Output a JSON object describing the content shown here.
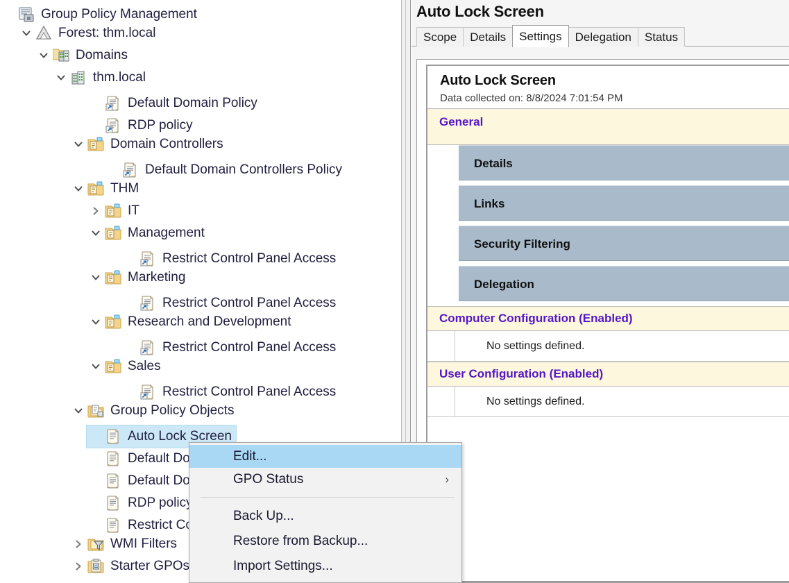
{
  "tree": {
    "items": [
      {
        "label": "Group Policy Management",
        "indent": 0,
        "twisty": "none",
        "icon": "console-root-icon"
      },
      {
        "label": "Forest: thm.local",
        "indent": 1,
        "twisty": "expanded",
        "icon": "forest-icon"
      },
      {
        "label": "Domains",
        "indent": 2,
        "twisty": "expanded",
        "icon": "domains-icon"
      },
      {
        "label": "thm.local",
        "indent": 3,
        "twisty": "expanded",
        "icon": "domain-icon"
      },
      {
        "label": "Default Domain Policy",
        "indent": 5,
        "twisty": "none",
        "icon": "gpo-link-icon"
      },
      {
        "label": "RDP policy",
        "indent": 5,
        "twisty": "none",
        "icon": "gpo-link-icon"
      },
      {
        "label": "Domain Controllers",
        "indent": 4,
        "twisty": "expanded",
        "icon": "ou-icon"
      },
      {
        "label": "Default Domain Controllers Policy",
        "indent": 6,
        "twisty": "none",
        "icon": "gpo-link-icon"
      },
      {
        "label": "THM",
        "indent": 4,
        "twisty": "expanded",
        "icon": "ou-icon"
      },
      {
        "label": "IT",
        "indent": 5,
        "twisty": "collapsed",
        "icon": "ou-icon"
      },
      {
        "label": "Management",
        "indent": 5,
        "twisty": "expanded",
        "icon": "ou-icon"
      },
      {
        "label": "Restrict Control Panel Access",
        "indent": 7,
        "twisty": "none",
        "icon": "gpo-link-icon"
      },
      {
        "label": "Marketing",
        "indent": 5,
        "twisty": "expanded",
        "icon": "ou-icon"
      },
      {
        "label": "Restrict Control Panel Access",
        "indent": 7,
        "twisty": "none",
        "icon": "gpo-link-icon"
      },
      {
        "label": "Research and Development",
        "indent": 5,
        "twisty": "expanded",
        "icon": "ou-icon"
      },
      {
        "label": "Restrict Control Panel Access",
        "indent": 7,
        "twisty": "none",
        "icon": "gpo-link-icon"
      },
      {
        "label": "Sales",
        "indent": 5,
        "twisty": "expanded",
        "icon": "ou-icon"
      },
      {
        "label": "Restrict Control Panel Access",
        "indent": 7,
        "twisty": "none",
        "icon": "gpo-link-icon"
      },
      {
        "label": "Group Policy Objects",
        "indent": 4,
        "twisty": "expanded",
        "icon": "gpo-container-icon"
      },
      {
        "label": "Auto Lock Screen",
        "indent": 5,
        "twisty": "none",
        "icon": "gpo-icon",
        "selected": true
      },
      {
        "label": "Default Domain Controllers Policy",
        "indent": 5,
        "twisty": "none",
        "icon": "gpo-icon"
      },
      {
        "label": "Default Domain Policy",
        "indent": 5,
        "twisty": "none",
        "icon": "gpo-icon"
      },
      {
        "label": "RDP policy",
        "indent": 5,
        "twisty": "none",
        "icon": "gpo-icon"
      },
      {
        "label": "Restrict Control Panel Access",
        "indent": 5,
        "twisty": "none",
        "icon": "gpo-icon"
      },
      {
        "label": "WMI Filters",
        "indent": 4,
        "twisty": "collapsed",
        "icon": "wmi-filter-icon"
      },
      {
        "label": "Starter GPOs",
        "indent": 4,
        "twisty": "collapsed",
        "icon": "starter-gpo-icon"
      }
    ]
  },
  "right": {
    "title": "Auto Lock Screen",
    "tabs": [
      {
        "label": "Scope",
        "active": false
      },
      {
        "label": "Details",
        "active": false
      },
      {
        "label": "Settings",
        "active": true
      },
      {
        "label": "Delegation",
        "active": false
      },
      {
        "label": "Status",
        "active": false
      }
    ],
    "report": {
      "heading": "Auto Lock Screen",
      "collected": "Data collected on: 8/8/2024 7:01:54 PM",
      "general_label": "General",
      "general_sections": [
        "Details",
        "Links",
        "Security Filtering",
        "Delegation"
      ],
      "computer_config_label": "Computer Configuration (Enabled)",
      "computer_config_value": "No settings defined.",
      "user_config_label": "User Configuration (Enabled)",
      "user_config_value": "No settings defined."
    }
  },
  "context_menu": {
    "items": [
      {
        "label": "Edit...",
        "highlight": true,
        "submenu": false
      },
      {
        "label": "GPO Status",
        "highlight": false,
        "submenu": true
      },
      {
        "label": "Back Up...",
        "highlight": false,
        "submenu": false
      },
      {
        "label": "Restore from Backup...",
        "highlight": false,
        "submenu": false
      },
      {
        "label": "Import Settings...",
        "highlight": false,
        "submenu": false
      }
    ],
    "submenu_arrow_glyph": "›"
  },
  "colors": {
    "selection_blue": "#cce8f7",
    "menu_highlight_blue": "#a8d8f4",
    "section_band_blue": "#a9bbcb",
    "cream_band": "#fdf8dd",
    "heading_purple": "#5516c8"
  }
}
